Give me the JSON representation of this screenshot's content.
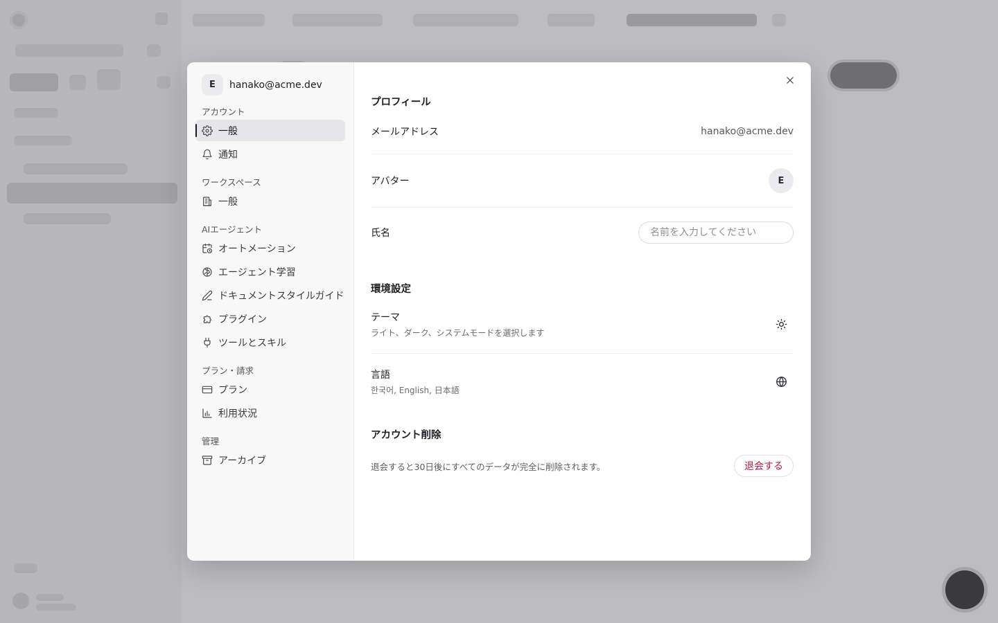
{
  "modal": {
    "user": {
      "initial": "E",
      "email": "hanako@acme.dev"
    },
    "nav_groups": [
      {
        "label": "アカウント",
        "items": [
          {
            "label": "一般",
            "icon": "gear-icon",
            "active": true
          },
          {
            "label": "通知",
            "icon": "bell-icon",
            "active": false
          }
        ]
      },
      {
        "label": "ワークスペース",
        "items": [
          {
            "label": "一般",
            "icon": "building-icon",
            "active": false
          }
        ]
      },
      {
        "label": "AIエージェント",
        "items": [
          {
            "label": "オートメーション",
            "icon": "calendar-clock-icon",
            "active": false
          },
          {
            "label": "エージェント学習",
            "icon": "brain-icon",
            "active": false
          },
          {
            "label": "ドキュメントスタイルガイド",
            "icon": "pen-icon",
            "active": false
          },
          {
            "label": "プラグイン",
            "icon": "puzzle-icon",
            "active": false
          },
          {
            "label": "ツールとスキル",
            "icon": "plug-icon",
            "active": false
          }
        ]
      },
      {
        "label": "プラン・請求",
        "items": [
          {
            "label": "プラン",
            "icon": "credit-card-icon",
            "active": false
          },
          {
            "label": "利用状況",
            "icon": "bar-chart-icon",
            "active": false
          }
        ]
      },
      {
        "label": "管理",
        "items": [
          {
            "label": "アーカイブ",
            "icon": "archive-icon",
            "active": false
          }
        ]
      }
    ],
    "profile": {
      "title": "プロフィール",
      "email_label": "メールアドレス",
      "email_value": "hanako@acme.dev",
      "avatar_label": "アバター",
      "avatar_initial": "E",
      "name_label": "氏名",
      "name_value": "",
      "name_placeholder": "名前を入力してください"
    },
    "preferences": {
      "title": "環境設定",
      "theme_label": "テーマ",
      "theme_sub": "ライト、ダーク、システムモードを選択します",
      "theme_icon": "sun-icon",
      "language_label": "言語",
      "language_sub": "한국어, English, 日本語",
      "language_icon": "globe-icon"
    },
    "delete_account": {
      "title": "アカウント削除",
      "description": "退会すると30日後にすべてのデータが完全に削除されます。",
      "button_label": "退会する",
      "button_color": "#b0203a"
    }
  }
}
